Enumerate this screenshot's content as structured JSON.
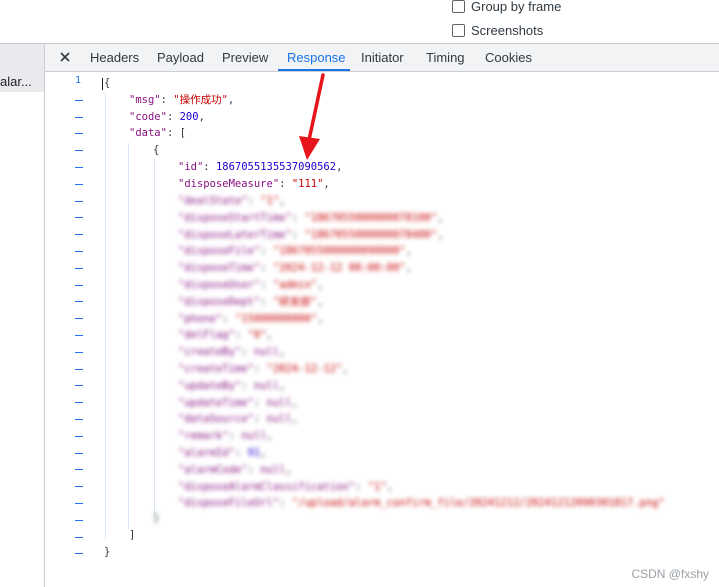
{
  "options": {
    "group_by_frame": "Group by frame",
    "screenshots": "Screenshots"
  },
  "tabs": [
    {
      "label": "Headers",
      "active": false
    },
    {
      "label": "Payload",
      "active": false
    },
    {
      "label": "Preview",
      "active": false
    },
    {
      "label": "Response",
      "active": true
    },
    {
      "label": "Initiator",
      "active": false
    },
    {
      "label": "Timing",
      "active": false
    },
    {
      "label": "Cookies",
      "active": false
    }
  ],
  "request_list": {
    "selected_item": "alar..."
  },
  "response": {
    "line_number": "1",
    "lines": {
      "open_brace": "{",
      "msg_key": "\"msg\"",
      "msg_value": "\"操作成功\"",
      "code_key": "\"code\"",
      "code_value": "200",
      "data_key": "\"data\"",
      "data_open": "[",
      "item_open": "{",
      "id_key": "\"id\"",
      "id_value": "1867055135537090562",
      "dispose_key": "\"disposeMeasure\"",
      "dispose_value": "\"111\"",
      "item_close": "}",
      "data_close": "]",
      "close_brace": "}"
    },
    "blurred_fields": [
      {
        "key": "\"dealState\"",
        "value": "\"1\"",
        "type": "str"
      },
      {
        "key": "\"disposeStartTime\"",
        "value": "\"1867055000000078100\"",
        "type": "str"
      },
      {
        "key": "\"disposeLaterTime\"",
        "value": "\"1867055000000078400\"",
        "type": "str"
      },
      {
        "key": "\"disposeFile\"",
        "value": "\"1867055000000090000\"",
        "type": "str"
      },
      {
        "key": "\"disposeTime\"",
        "value": "\"2024-12-12 00:00:00\"",
        "type": "str"
      },
      {
        "key": "\"disposeUser\"",
        "value": "\"admin\"",
        "type": "str"
      },
      {
        "key": "\"disposeDept\"",
        "value": "\"研发部\"",
        "type": "str"
      },
      {
        "key": "\"phone\"",
        "value": "\"15000000000\"",
        "type": "str"
      },
      {
        "key": "\"delFlag\"",
        "value": "\"0\"",
        "type": "str"
      },
      {
        "key": "\"createBy\"",
        "value": "null",
        "type": "null"
      },
      {
        "key": "\"createTime\"",
        "value": "\"2024-12-12\"",
        "type": "str"
      },
      {
        "key": "\"updateBy\"",
        "value": "null",
        "type": "null"
      },
      {
        "key": "\"updateTime\"",
        "value": "null",
        "type": "null"
      },
      {
        "key": "\"dataSource\"",
        "value": "null",
        "type": "null"
      },
      {
        "key": "\"remark\"",
        "value": "null",
        "type": "null"
      },
      {
        "key": "\"alarmId\"",
        "value": "91",
        "type": "num"
      },
      {
        "key": "\"alarmCode\"",
        "value": "null",
        "type": "null"
      },
      {
        "key": "\"disposeAlarmClassification\"",
        "value": "\"1\"",
        "type": "str"
      },
      {
        "key": "\"disposeFileUrl\"",
        "value": "\"/upload/alarm_confirm_file/20241212/20241212090301817.png\"",
        "type": "str"
      }
    ]
  },
  "watermark": "CSDN @fxshy",
  "colors": {
    "active_tab": "#1a73e8",
    "key": "#881280",
    "string": "#c80000",
    "number": "#1c00cf",
    "arrow": "#e8141b"
  }
}
